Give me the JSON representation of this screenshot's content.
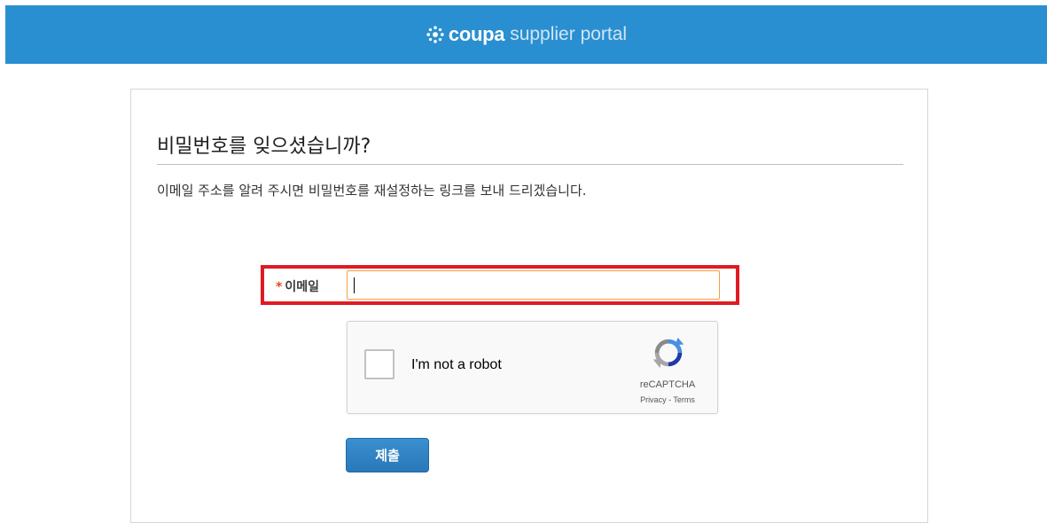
{
  "header": {
    "brand_name": "coupa",
    "brand_sub": "supplier portal",
    "background_color": "#2a8fd1"
  },
  "form": {
    "title": "비밀번호를 잊으셨습니까?",
    "description": "이메일 주소를 알려 주시면 비밀번호를 재설정하는 링크를 보내 드리겠습니다.",
    "email_required_marker": "*",
    "email_label": "이메일",
    "email_value": "",
    "submit_label": "제출",
    "highlight_color": "#e01a24"
  },
  "recaptcha": {
    "label": "I'm not a robot",
    "brand": "reCAPTCHA",
    "privacy": "Privacy",
    "separator": " - ",
    "terms": "Terms",
    "checked": false
  }
}
